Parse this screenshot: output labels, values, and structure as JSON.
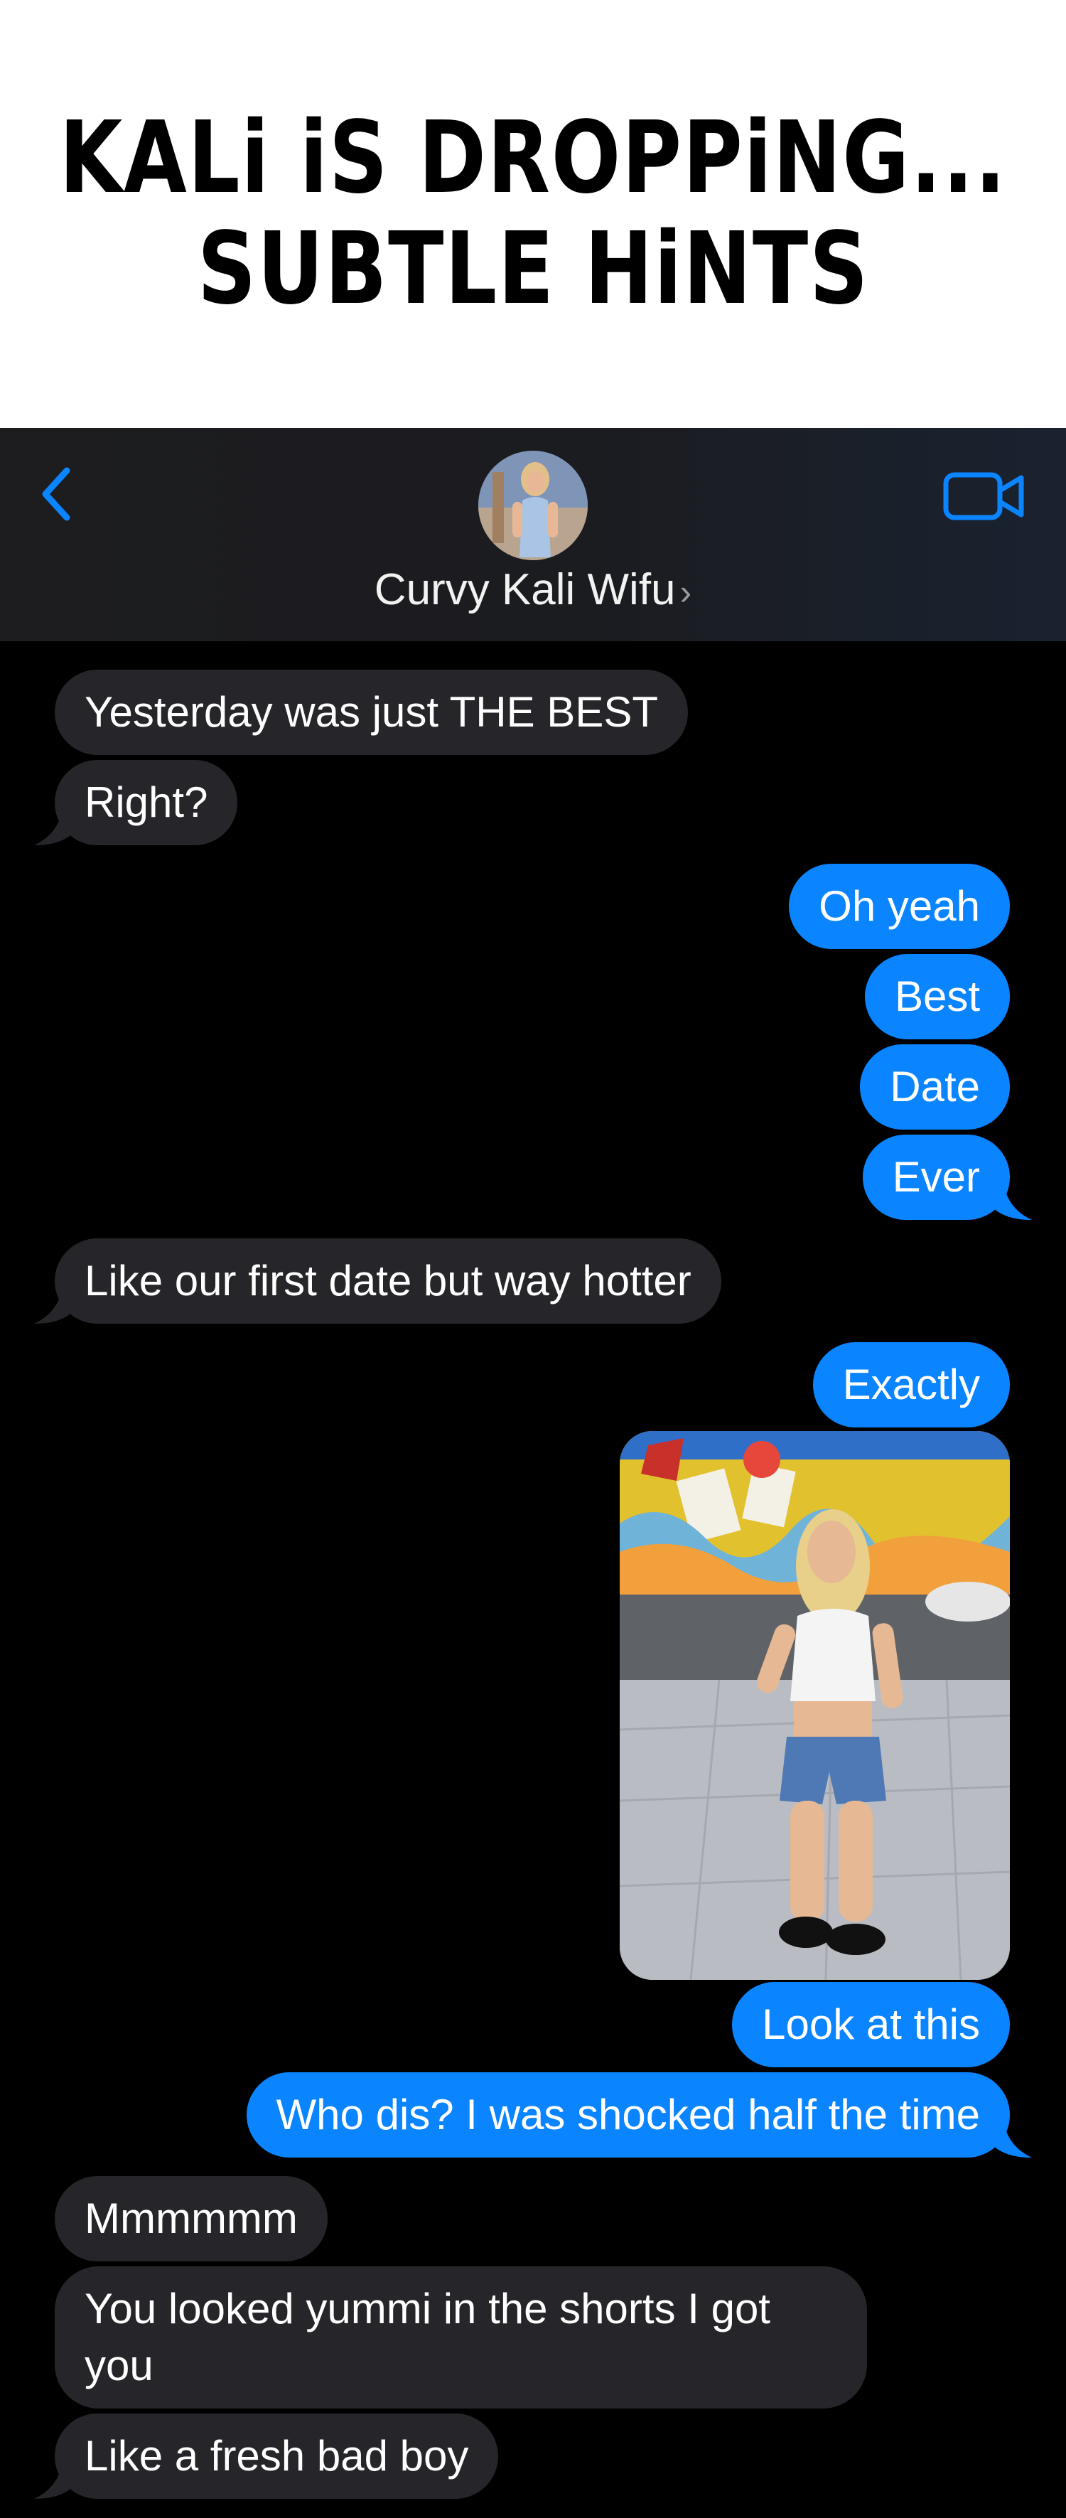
{
  "title": {
    "line1": "KALi iS DROPPiNG...",
    "line2": "SUBTLE HiNTS"
  },
  "header": {
    "contact_name": "Curvy Kali Wifu",
    "chevron": "›",
    "back_icon": "chevron-left-icon",
    "video_icon": "video-camera-icon",
    "accent_color": "#0a84ff"
  },
  "messages": [
    {
      "side": "in",
      "text": "Yesterday was just THE BEST"
    },
    {
      "side": "in",
      "text": "Right?"
    },
    {
      "side": "out",
      "text": "Oh yeah"
    },
    {
      "side": "out",
      "text": "Best"
    },
    {
      "side": "out",
      "text": "Date"
    },
    {
      "side": "out",
      "text": "Ever"
    },
    {
      "side": "in",
      "text": "Like our first date but way hotter"
    },
    {
      "side": "out",
      "text": "Exactly"
    },
    {
      "side": "out",
      "type": "photo"
    },
    {
      "side": "out",
      "text": "Look at this"
    },
    {
      "side": "out",
      "text": "Who dis? I was shocked half the time"
    },
    {
      "side": "in",
      "text": "Mmmmmm"
    },
    {
      "side": "in",
      "text": "You looked yummi in the shorts I got you"
    },
    {
      "side": "in",
      "text": "Like a fresh bad boy"
    }
  ],
  "colors": {
    "incoming_bubble": "#26252a",
    "outgoing_bubble": "#0a84ff",
    "background": "#000000"
  }
}
